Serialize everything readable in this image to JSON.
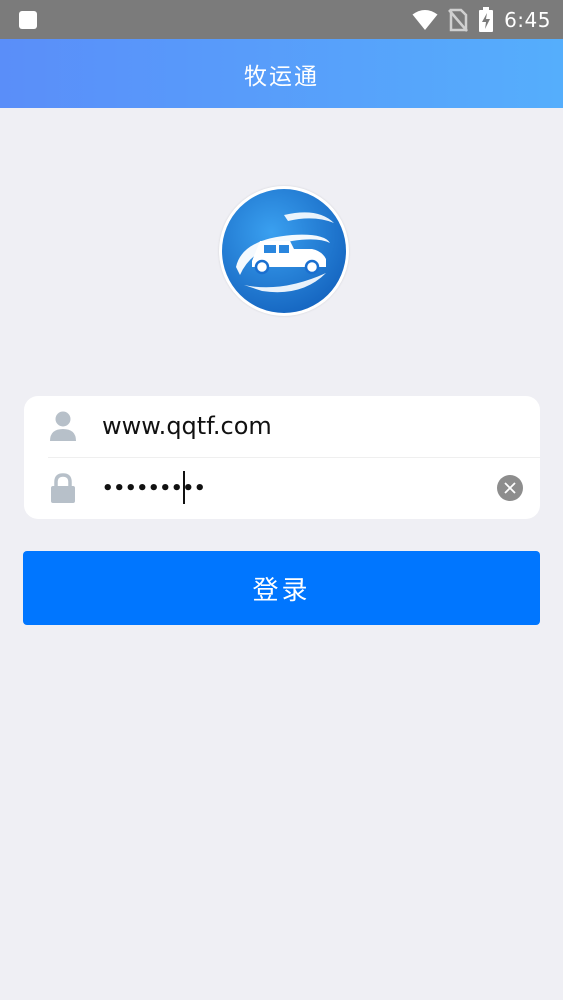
{
  "status_bar": {
    "time": "6:45",
    "icons": [
      "notification-icon",
      "wifi-icon",
      "no-sim-icon",
      "battery-charging-icon"
    ]
  },
  "header": {
    "title": "牧运通"
  },
  "logo": {
    "icon": "truck-logo-icon"
  },
  "form": {
    "username": {
      "icon": "user-icon",
      "value": "www.qqtf.com"
    },
    "password": {
      "icon": "lock-icon",
      "masked_value": "•••••••••",
      "clear_icon": "clear-icon"
    }
  },
  "login_button": {
    "label": "登录"
  },
  "colors": {
    "status_bar": "#7b7b7b",
    "header_start": "#5a8ef9",
    "header_end": "#55aefc",
    "background": "#efeff4",
    "button": "#0076ff",
    "icon_gray": "#b7c0c9"
  }
}
